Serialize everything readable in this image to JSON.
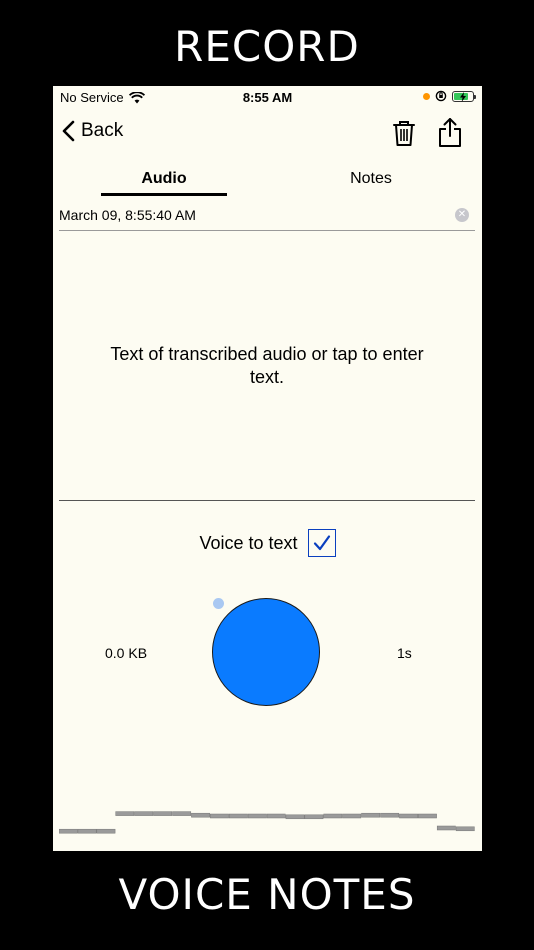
{
  "promo": {
    "top_caption": "RECORD",
    "bottom_caption": "VOICE NOTES"
  },
  "status_bar": {
    "carrier": "No Service",
    "time": "8:55 AM",
    "icons": [
      "wifi-icon",
      "orange-dot-indicator",
      "rotation-lock-icon",
      "battery-charging-icon"
    ],
    "battery_level": 0.75
  },
  "nav": {
    "back_label": "Back",
    "icons": [
      "chevron-left-icon",
      "trash-icon",
      "share-icon"
    ]
  },
  "tabs": [
    {
      "label": "Audio",
      "selected": true
    },
    {
      "label": "Notes",
      "selected": false
    }
  ],
  "note": {
    "title": "March 09, 8:55:40 AM",
    "transcript_placeholder": "Text of transcribed audio or tap to enter text."
  },
  "voice_to_text": {
    "label": "Voice to text",
    "checked": true
  },
  "recording": {
    "size": "0.0 KB",
    "duration": "1s"
  },
  "waveform_levels": [
    0.22,
    0.22,
    0.22,
    0.66,
    0.66,
    0.66,
    0.66,
    0.62,
    0.6,
    0.6,
    0.6,
    0.6,
    0.58,
    0.58,
    0.6,
    0.6,
    0.62,
    0.62,
    0.6,
    0.6,
    0.3,
    0.28
  ],
  "colors": {
    "accent": "#0a7bff",
    "background": "#fdfcf2",
    "checkbox": "#0a3fbf",
    "battery": "#34c759",
    "privacy_dot": "#ff9500"
  }
}
